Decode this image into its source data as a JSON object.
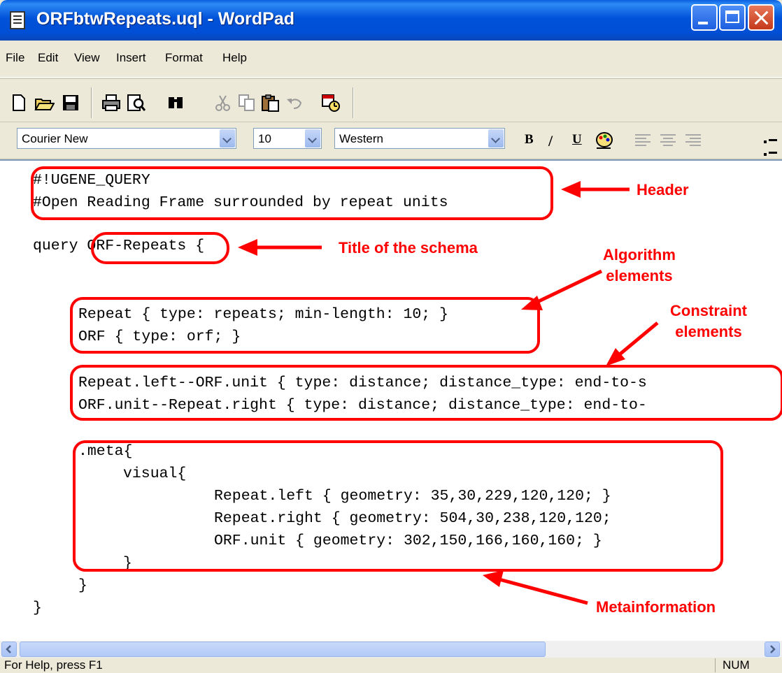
{
  "window": {
    "title": "ORFbtwRepeats.uql - WordPad"
  },
  "menu": [
    "File",
    "Edit",
    "View",
    "Insert",
    "Format",
    "Help"
  ],
  "toolbar_icons": [
    "new-document-icon",
    "open-folder-icon",
    "save-icon",
    "print-icon",
    "print-preview-icon",
    "find-icon",
    "cut-icon",
    "copy-icon",
    "paste-icon",
    "undo-icon",
    "insert-date-time-icon"
  ],
  "format": {
    "font": "Courier New",
    "size": "10",
    "script": "Western",
    "bold": "B",
    "italic": "/",
    "underline": "U"
  },
  "document": {
    "lines": [
      "#!UGENE_QUERY",
      "#Open Reading Frame surrounded by repeat units",
      "query ORF-Repeats {",
      "Repeat { type: repeats; min-length: 10; }",
      "ORF { type: orf; }",
      "Repeat.left--ORF.unit { type: distance; distance_type: end-to-s",
      "ORF.unit--Repeat.right { type: distance; distance_type: end-to-",
      ".meta{",
      "visual{",
      "Repeat.left { geometry: 35,30,229,120,120; }",
      "Repeat.right { geometry: 504,30,238,120,120;",
      "ORF.unit { geometry: 302,150,166,160,160; }",
      "}",
      "}",
      "}"
    ]
  },
  "annotations": {
    "header": "Header",
    "title": "Title of the schema",
    "algorithm": [
      "Algorithm",
      "elements"
    ],
    "constraint": [
      "Constraint",
      "elements"
    ],
    "meta": "Metainformation"
  },
  "colors": {
    "annotation": "#ff0000",
    "titlebar": "#0054e3"
  },
  "status": {
    "help": "For Help, press F1",
    "num": "NUM"
  }
}
